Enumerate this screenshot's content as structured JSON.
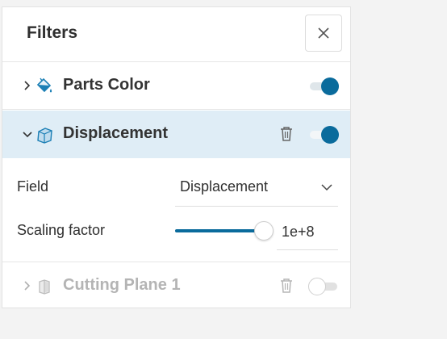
{
  "panel": {
    "title": "Filters",
    "close_icon": "close-icon"
  },
  "filters": [
    {
      "label": "Parts Color",
      "icon": "paint-bucket-icon",
      "expanded": false,
      "enabled": true,
      "has_delete": false
    },
    {
      "label": "Displacement",
      "icon": "displacement-icon",
      "expanded": true,
      "enabled": true,
      "has_delete": true
    },
    {
      "label": "Cutting Plane 1",
      "icon": "cutting-plane-icon",
      "expanded": false,
      "enabled": false,
      "has_delete": true
    }
  ],
  "displacement": {
    "field_label": "Field",
    "field_value": "Displacement",
    "scaling_label": "Scaling factor",
    "scaling_value": "1e+8",
    "slider_fraction": 0.9
  },
  "colors": {
    "accent": "#0a6b9c",
    "selected_row": "#dfedf6",
    "icon_blue": "#1b7fb5"
  }
}
